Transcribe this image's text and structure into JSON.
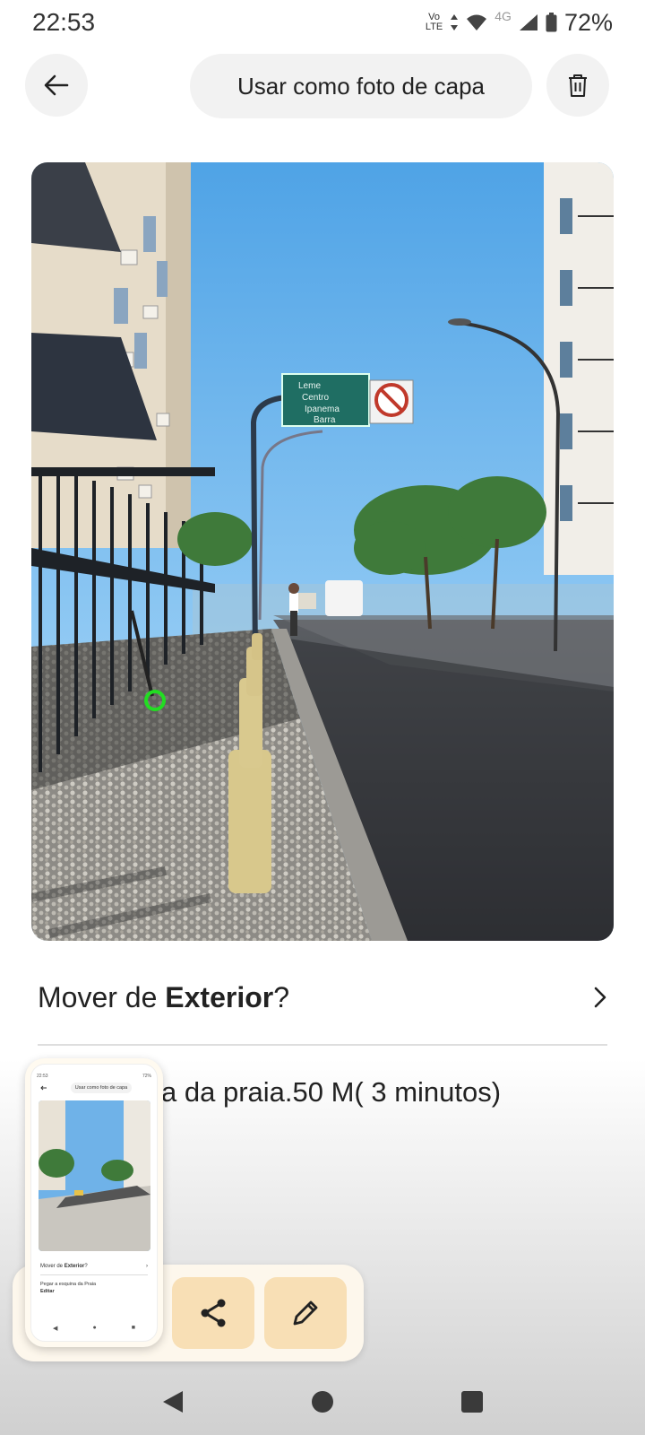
{
  "status_bar": {
    "time": "22:53",
    "volte_top": "Vo",
    "volte_bottom": "LTE",
    "network": "4G",
    "battery": "72%"
  },
  "header": {
    "back_icon": "arrow-left-icon",
    "cover_button_label": "Usar como foto de capa",
    "delete_icon": "trash-icon"
  },
  "photo": {
    "sign_line1": "Leme",
    "sign_line2": "Centro",
    "sign_line3": "Ipanema",
    "sign_line4": "Barra"
  },
  "move": {
    "prefix": "Mover de ",
    "category": "Exterior",
    "suffix": "?"
  },
  "description": "a da praia.50 M( 3 minutos)",
  "thumbnail": {
    "cover_label": "Usar como foto de capa",
    "move_prefix": "Mover de ",
    "move_category": "Exterior",
    "move_suffix": "?",
    "description": "Pegar a esquina da Praia",
    "edit_label": "Editar"
  },
  "toolbar": {
    "share_icon": "share-icon",
    "edit_icon": "pencil-icon"
  },
  "nav": {
    "back": "back-triangle-icon",
    "home": "home-circle-icon",
    "recents": "recents-square-icon"
  },
  "colors": {
    "accent_button": "#f8dfb5",
    "toolbar_bg": "#fdf7ec",
    "pill_bg": "#f2f2f2"
  }
}
